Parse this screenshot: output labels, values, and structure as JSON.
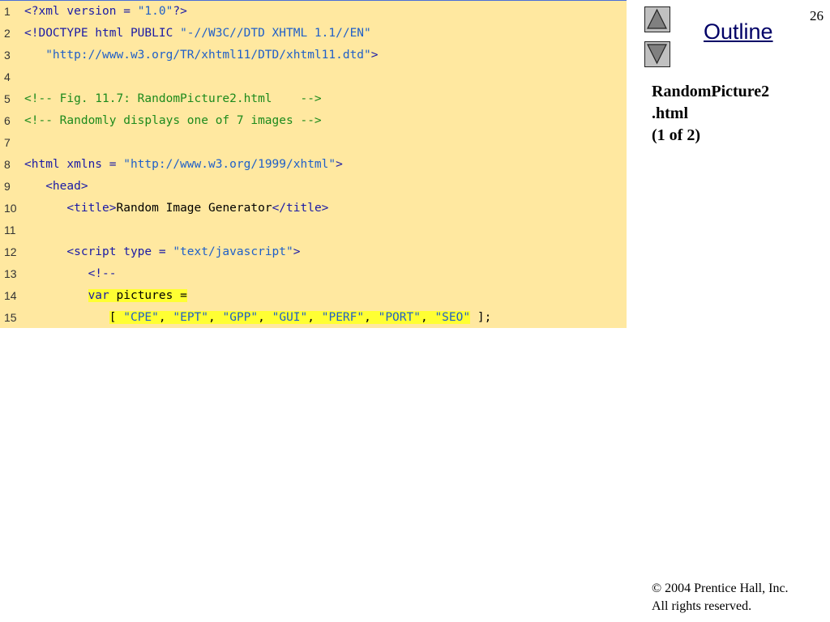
{
  "page_number": "26",
  "nav": {
    "outline_label": "Outline",
    "up_icon": "triangle-up-icon",
    "down_icon": "triangle-down-icon"
  },
  "slide_title": {
    "line1": "RandomPicture2",
    "line2": ".html",
    "line3": "(1 of 2)"
  },
  "footer": {
    "copyright_symbol": "©",
    "copyright_text": " 2004 Prentice Hall, Inc.",
    "rights": "All rights reserved."
  },
  "colors": {
    "panel_background": "#ffe8a0",
    "keyword": "#1a1aa6",
    "string": "#2060c8",
    "comment": "#1c8a1c",
    "highlight": "#ffff33"
  },
  "code_lines": [
    {
      "number": "1",
      "segments": [
        {
          "text": "<?xml version = ",
          "style": "k"
        },
        {
          "text": "\"1.0\"",
          "style": "s"
        },
        {
          "text": "?>",
          "style": "k"
        }
      ]
    },
    {
      "number": "2",
      "segments": [
        {
          "text": "<!DOCTYPE html PUBLIC ",
          "style": "k"
        },
        {
          "text": "\"-//W3C//DTD XHTML 1.1//EN\"",
          "style": "s"
        }
      ]
    },
    {
      "number": "3",
      "segments": [
        {
          "text": "   \"http://www.w3.org/TR/xhtml11/DTD/xhtml11.dtd\"",
          "style": "s"
        },
        {
          "text": ">",
          "style": "k"
        }
      ]
    },
    {
      "number": "4",
      "segments": []
    },
    {
      "number": "5",
      "segments": [
        {
          "text": "<!-- Fig. 11.7: RandomPicture2.html    -->",
          "style": "c"
        }
      ]
    },
    {
      "number": "6",
      "segments": [
        {
          "text": "<!-- Randomly displays one of 7 images -->",
          "style": "c"
        }
      ]
    },
    {
      "number": "7",
      "segments": []
    },
    {
      "number": "8",
      "segments": [
        {
          "text": "<html xmlns = ",
          "style": "k"
        },
        {
          "text": "\"http://www.w3.org/1999/xhtml\"",
          "style": "s"
        },
        {
          "text": ">",
          "style": "k"
        }
      ]
    },
    {
      "number": "9",
      "segments": [
        {
          "text": "   <head>",
          "style": "k"
        }
      ]
    },
    {
      "number": "10",
      "segments": [
        {
          "text": "      <title>",
          "style": "k"
        },
        {
          "text": "Random Image Generator",
          "style": "t"
        },
        {
          "text": "</title>",
          "style": "k"
        }
      ]
    },
    {
      "number": "11",
      "segments": []
    },
    {
      "number": "12",
      "segments": [
        {
          "text": "      <script type = ",
          "style": "k"
        },
        {
          "text": "\"text/javascript\"",
          "style": "s"
        },
        {
          "text": ">",
          "style": "k"
        }
      ]
    },
    {
      "number": "13",
      "segments": [
        {
          "text": "         <!--",
          "style": "k"
        }
      ]
    },
    {
      "number": "14",
      "segments": [
        {
          "text": "         ",
          "style": "t"
        },
        {
          "text": "var",
          "style": "k hl"
        },
        {
          "text": " pictures =",
          "style": "t hl"
        }
      ]
    },
    {
      "number": "15",
      "segments": [
        {
          "text": "            ",
          "style": "t"
        },
        {
          "text": "[ ",
          "style": "t hl"
        },
        {
          "text": "\"CPE\"",
          "style": "s hl"
        },
        {
          "text": ", ",
          "style": "t hl"
        },
        {
          "text": "\"EPT\"",
          "style": "s hl"
        },
        {
          "text": ", ",
          "style": "t hl"
        },
        {
          "text": "\"GPP\"",
          "style": "s hl"
        },
        {
          "text": ", ",
          "style": "t hl"
        },
        {
          "text": "\"GUI\"",
          "style": "s hl"
        },
        {
          "text": ", ",
          "style": "t hl"
        },
        {
          "text": "\"PERF\"",
          "style": "s hl"
        },
        {
          "text": ", ",
          "style": "t hl"
        },
        {
          "text": "\"PORT\"",
          "style": "s hl"
        },
        {
          "text": ", ",
          "style": "t hl"
        },
        {
          "text": "\"SEO\"",
          "style": "s hl"
        },
        {
          "text": " ];",
          "style": "t"
        }
      ]
    }
  ]
}
